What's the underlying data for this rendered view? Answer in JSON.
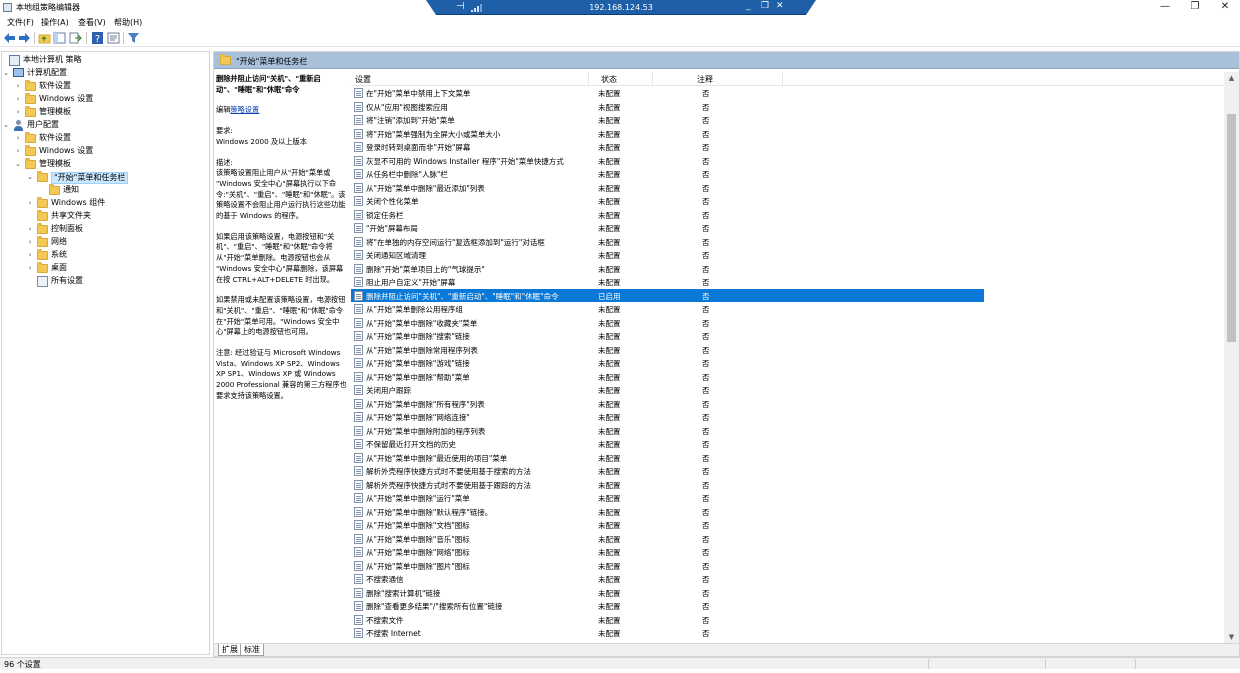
{
  "window": {
    "title": "本地组策略编辑器",
    "minimize_glyph": "—",
    "restore_glyph": "❐",
    "close_glyph": "✕"
  },
  "remote_bar": {
    "host": "192.168.124.53",
    "pin_glyph": "⊣",
    "minimize_glyph": "_",
    "restore_glyph": "❐",
    "close_glyph": "✕"
  },
  "menu": [
    "文件(F)",
    "操作(A)",
    "查看(V)",
    "帮助(H)"
  ],
  "toolbar": {
    "icons": [
      "back-icon",
      "forward-icon",
      "up-folder-icon",
      "show-hide-tree-icon",
      "export-list-icon",
      "help-icon",
      "properties-icon",
      "filter-icon"
    ]
  },
  "tree": {
    "items": [
      {
        "label": "本地计算机 策略",
        "level": 0,
        "toggle": "",
        "icon": "policy"
      },
      {
        "label": "计算机配置",
        "level": 1,
        "toggle": "⌄",
        "icon": "computer"
      },
      {
        "label": "软件设置",
        "level": 2,
        "toggle": "›",
        "icon": "folder"
      },
      {
        "label": "Windows 设置",
        "level": 2,
        "toggle": "›",
        "icon": "folder"
      },
      {
        "label": "管理模板",
        "level": 2,
        "toggle": "›",
        "icon": "folder"
      },
      {
        "label": "用户配置",
        "level": 1,
        "toggle": "⌄",
        "icon": "user"
      },
      {
        "label": "软件设置",
        "level": 2,
        "toggle": "›",
        "icon": "folder"
      },
      {
        "label": "Windows 设置",
        "level": 2,
        "toggle": "›",
        "icon": "folder"
      },
      {
        "label": "管理模板",
        "level": 2,
        "toggle": "⌄",
        "icon": "folder"
      },
      {
        "label": "\"开始\"菜单和任务栏",
        "level": 3,
        "toggle": "⌄",
        "icon": "folder",
        "selected": true
      },
      {
        "label": "通知",
        "level": 4,
        "toggle": "",
        "icon": "folder"
      },
      {
        "label": "Windows 组件",
        "level": 3,
        "toggle": "›",
        "icon": "folder"
      },
      {
        "label": "共享文件夹",
        "level": 3,
        "toggle": "",
        "icon": "folder"
      },
      {
        "label": "控制面板",
        "level": 3,
        "toggle": "›",
        "icon": "folder"
      },
      {
        "label": "网络",
        "level": 3,
        "toggle": "›",
        "icon": "folder"
      },
      {
        "label": "系统",
        "level": 3,
        "toggle": "›",
        "icon": "folder"
      },
      {
        "label": "桌面",
        "level": 3,
        "toggle": "›",
        "icon": "folder"
      },
      {
        "label": "所有设置",
        "level": 3,
        "toggle": "",
        "icon": "settings"
      }
    ]
  },
  "pane_header": "\"开始\"菜单和任务栏",
  "description": {
    "title": "删除并阻止访问\"关机\"、\"重新启动\"、\"睡眠\"和\"休眠\"命令",
    "edit_prefix": "编辑",
    "edit_link": "策略设置",
    "requirements_label": "要求:",
    "requirements": "Windows 2000 及以上版本",
    "desc_label": "描述:",
    "p1": "该策略设置阻止用户从\"开始\"菜单或 \"Windows 安全中心\"屏幕执行以下命令:\"关机\"、\"重启\"、\"睡眠\"和\"休眠\"。该策略设置不会阻止用户运行执行这些功能的基于 Windows 的程序。",
    "p2": "如果启用该策略设置，电源按钮和\"关机\"、\"重启\"、\"睡眠\"和\"休眠\"命令将从\"开始\"菜单删除。电源按钮也会从 \"Windows 安全中心\"屏幕删除，该屏幕在按 CTRL+ALT+DELETE 时出现。",
    "p3": "如果禁用或未配置该策略设置，电源按钮和\"关机\"、\"重启\"、\"睡眠\"和\"休眠\"命令在\"开始\"菜单可用。\"Windows 安全中心\"屏幕上的电源按钮也可用。",
    "p4": "注意: 经过验证与 Microsoft Windows Vista、Windows XP SP2、Windows XP SP1、Windows XP 或 Windows 2000 Professional 兼容的第三方程序也要求支持该策略设置。"
  },
  "columns": {
    "setting": "设置",
    "state": "状态",
    "comment": "注释"
  },
  "rows": [
    {
      "setting": "在\"开始\"菜单中禁用上下文菜单",
      "state": "未配置",
      "comment": "否"
    },
    {
      "setting": "仅从\"应用\"视图搜索应用",
      "state": "未配置",
      "comment": "否"
    },
    {
      "setting": "将\"注销\"添加到\"开始\"菜单",
      "state": "未配置",
      "comment": "否"
    },
    {
      "setting": "将\"开始\"菜单强制为全屏大小或菜单大小",
      "state": "未配置",
      "comment": "否"
    },
    {
      "setting": "登录时转到桌面而非\"开始\"屏幕",
      "state": "未配置",
      "comment": "否"
    },
    {
      "setting": "灰显不可用的 Windows Installer 程序\"开始\"菜单快捷方式",
      "state": "未配置",
      "comment": "否"
    },
    {
      "setting": "从任务栏中删除\"人脉\"栏",
      "state": "未配置",
      "comment": "否"
    },
    {
      "setting": "从\"开始\"菜单中删除\"最近添加\"列表",
      "state": "未配置",
      "comment": "否"
    },
    {
      "setting": "关闭个性化菜单",
      "state": "未配置",
      "comment": "否"
    },
    {
      "setting": "锁定任务栏",
      "state": "未配置",
      "comment": "否"
    },
    {
      "setting": "\"开始\"屏幕布局",
      "state": "未配置",
      "comment": "否"
    },
    {
      "setting": "将\"在单独的内存空间运行\"复选框添加到\"运行\"对话框",
      "state": "未配置",
      "comment": "否"
    },
    {
      "setting": "关闭通知区域清理",
      "state": "未配置",
      "comment": "否"
    },
    {
      "setting": "删除\"开始\"菜单项目上的\"气球提示\"",
      "state": "未配置",
      "comment": "否"
    },
    {
      "setting": "阻止用户自定义\"开始\"屏幕",
      "state": "未配置",
      "comment": "否"
    },
    {
      "setting": "删除并阻止访问\"关机\"、\"重新启动\"、\"睡眠\"和\"休眠\"命令",
      "state": "已启用",
      "comment": "否",
      "selected": true
    },
    {
      "setting": "从\"开始\"菜单删除公用程序组",
      "state": "未配置",
      "comment": "否"
    },
    {
      "setting": "从\"开始\"菜单中删除\"收藏夹\"菜单",
      "state": "未配置",
      "comment": "否"
    },
    {
      "setting": "从\"开始\"菜单中删除\"搜索\"链接",
      "state": "未配置",
      "comment": "否"
    },
    {
      "setting": "从\"开始\"菜单中删除常用程序列表",
      "state": "未配置",
      "comment": "否"
    },
    {
      "setting": "从\"开始\"菜单中删除\"游戏\"链接",
      "state": "未配置",
      "comment": "否"
    },
    {
      "setting": "从\"开始\"菜单中删除\"帮助\"菜单",
      "state": "未配置",
      "comment": "否"
    },
    {
      "setting": "关闭用户跟踪",
      "state": "未配置",
      "comment": "否"
    },
    {
      "setting": "从\"开始\"菜单中删除\"所有程序\"列表",
      "state": "未配置",
      "comment": "否"
    },
    {
      "setting": "从\"开始\"菜单中删除\"网络连接\"",
      "state": "未配置",
      "comment": "否"
    },
    {
      "setting": "从\"开始\"菜单中删除附加的程序列表",
      "state": "未配置",
      "comment": "否"
    },
    {
      "setting": "不保留最近打开文档的历史",
      "state": "未配置",
      "comment": "否"
    },
    {
      "setting": "从\"开始\"菜单中删除\"最近使用的项目\"菜单",
      "state": "未配置",
      "comment": "否"
    },
    {
      "setting": "解析外壳程序快捷方式时不要使用基于搜索的方法",
      "state": "未配置",
      "comment": "否"
    },
    {
      "setting": "解析外壳程序快捷方式时不要使用基于跟踪的方法",
      "state": "未配置",
      "comment": "否"
    },
    {
      "setting": "从\"开始\"菜单中删除\"运行\"菜单",
      "state": "未配置",
      "comment": "否"
    },
    {
      "setting": "从\"开始\"菜单中删除\"默认程序\"链接。",
      "state": "未配置",
      "comment": "否"
    },
    {
      "setting": "从\"开始\"菜单中删除\"文档\"图标",
      "state": "未配置",
      "comment": "否"
    },
    {
      "setting": "从\"开始\"菜单中删除\"音乐\"图标",
      "state": "未配置",
      "comment": "否"
    },
    {
      "setting": "从\"开始\"菜单中删除\"网络\"图标",
      "state": "未配置",
      "comment": "否"
    },
    {
      "setting": "从\"开始\"菜单中删除\"图片\"图标",
      "state": "未配置",
      "comment": "否"
    },
    {
      "setting": "不搜索通信",
      "state": "未配置",
      "comment": "否"
    },
    {
      "setting": "删除\"搜索计算机\"链接",
      "state": "未配置",
      "comment": "否"
    },
    {
      "setting": "删除\"查看更多结果\"/\"搜索所有位置\"链接",
      "state": "未配置",
      "comment": "否"
    },
    {
      "setting": "不搜索文件",
      "state": "未配置",
      "comment": "否"
    },
    {
      "setting": "不搜索 Internet",
      "state": "未配置",
      "comment": "否"
    }
  ],
  "tabs": [
    "扩展",
    "标准"
  ],
  "status": "96 个设置",
  "colors": {
    "selection": "#0a78d7",
    "header_band": "#a8c0d8",
    "tree_selection": "#cce8ff",
    "remote_bar": "#1e5fa8"
  }
}
